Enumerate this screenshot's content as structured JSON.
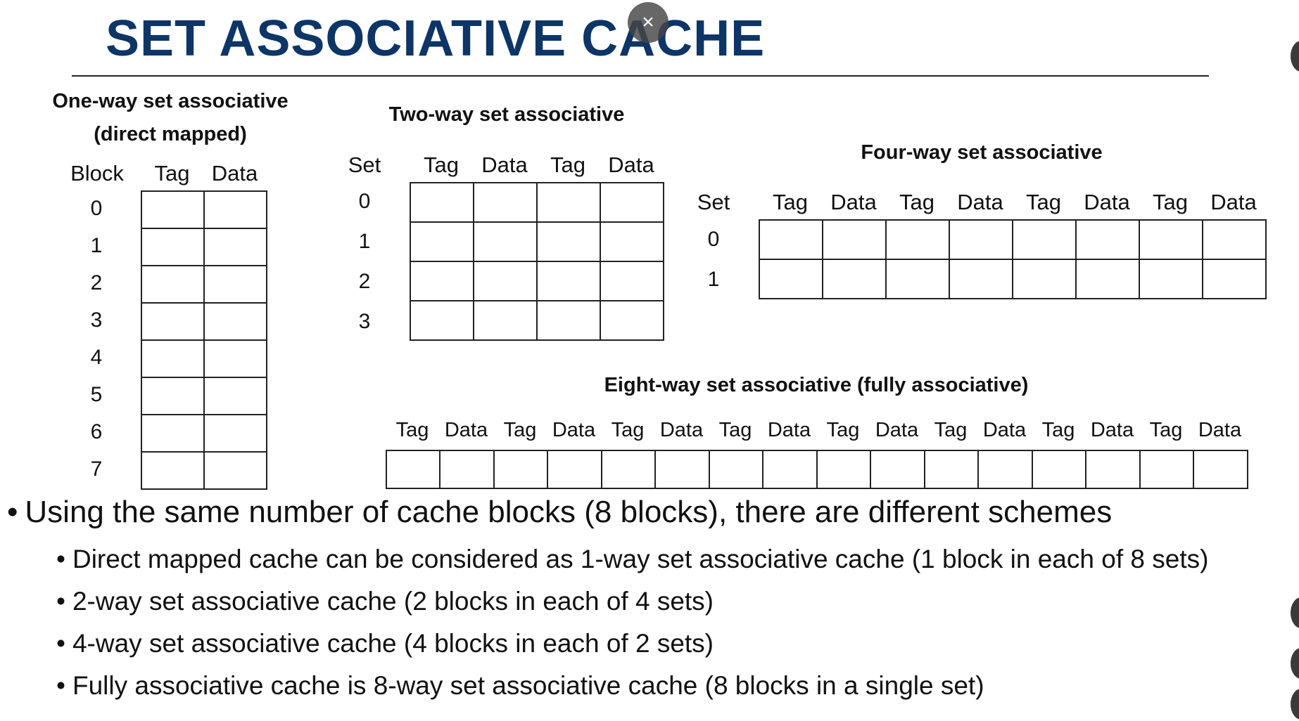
{
  "slide": {
    "title": "SET ASSOCIATIVE CACHE",
    "title_color": "#0d3566"
  },
  "overlay": {
    "close_glyph": "×"
  },
  "diagrams": {
    "one_way": {
      "heading_line1": "One-way set associative",
      "heading_line2": "(direct mapped)",
      "columns": [
        "Block",
        "Tag",
        "Data"
      ],
      "rows": [
        "0",
        "1",
        "2",
        "3",
        "4",
        "5",
        "6",
        "7"
      ]
    },
    "two_way": {
      "heading": "Two-way set associative",
      "columns": [
        "Set",
        "Tag",
        "Data",
        "Tag",
        "Data"
      ],
      "rows": [
        "0",
        "1",
        "2",
        "3"
      ]
    },
    "four_way": {
      "heading": "Four-way set associative",
      "columns": [
        "Set",
        "Tag",
        "Data",
        "Tag",
        "Data",
        "Tag",
        "Data",
        "Tag",
        "Data"
      ],
      "rows": [
        "0",
        "1"
      ]
    },
    "eight_way": {
      "heading": "Eight-way set associative (fully associative)",
      "columns": [
        "Tag",
        "Data",
        "Tag",
        "Data",
        "Tag",
        "Data",
        "Tag",
        "Data",
        "Tag",
        "Data",
        "Tag",
        "Data",
        "Tag",
        "Data",
        "Tag",
        "Data"
      ]
    }
  },
  "bullets": {
    "glyph": "•",
    "main": "Using the same number of cache blocks (8 blocks), there are different schemes",
    "sub": [
      "Direct mapped cache can be considered as 1-way set associative cache (1 block in each of 8 sets)",
      "2-way set associative cache (2 blocks in each of 4 sets)",
      "4-way set associative cache (4 blocks in each of 2 sets)",
      "Fully associative cache is 8-way set associative cache (8 blocks in a single set)"
    ]
  }
}
